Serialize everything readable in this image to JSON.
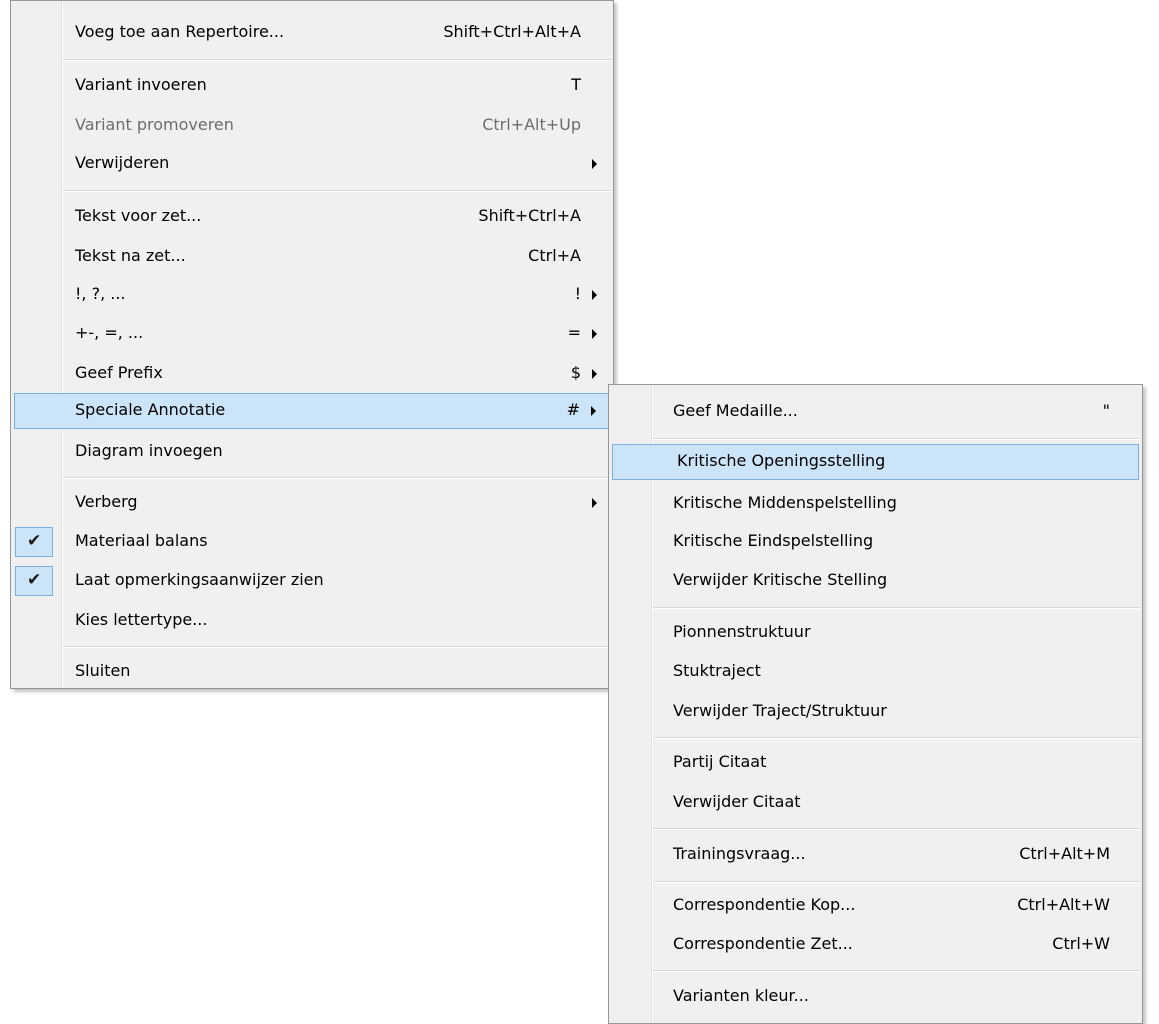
{
  "main_menu": {
    "items": [
      {
        "label": "Voeg toe aan Repertoire...",
        "shortcut": "Shift+Ctrl+Alt+A"
      },
      {
        "label": "Variant invoeren",
        "shortcut": "T"
      },
      {
        "label": "Variant promoveren",
        "shortcut": "Ctrl+Alt+Up",
        "disabled": true
      },
      {
        "label": "Verwijderen",
        "shortcut": ""
      },
      {
        "label": "Tekst voor zet...",
        "shortcut": "Shift+Ctrl+A"
      },
      {
        "label": "Tekst na zet...",
        "shortcut": "Ctrl+A"
      },
      {
        "label": "!, ?, ...",
        "shortcut": "!"
      },
      {
        "label": "+-, =, ...",
        "shortcut": "="
      },
      {
        "label": "Geef Prefix",
        "shortcut": "$"
      },
      {
        "label": "Speciale Annotatie",
        "shortcut": "#",
        "highlighted": true
      },
      {
        "label": "Diagram invoegen",
        "shortcut": ""
      },
      {
        "label": "Verberg",
        "shortcut": ""
      },
      {
        "label": "Materiaal balans",
        "shortcut": "",
        "checked": true
      },
      {
        "label": "Laat opmerkingsaanwijzer zien",
        "shortcut": "",
        "checked": true
      },
      {
        "label": "Kies lettertype...",
        "shortcut": ""
      },
      {
        "label": "Sluiten",
        "shortcut": ""
      }
    ]
  },
  "sub_menu": {
    "items": [
      {
        "label": "Geef Medaille...",
        "shortcut": "\""
      },
      {
        "label": "Kritische Openingsstelling",
        "shortcut": "",
        "highlighted": true
      },
      {
        "label": "Kritische Middenspelstelling",
        "shortcut": ""
      },
      {
        "label": "Kritische Eindspelstelling",
        "shortcut": ""
      },
      {
        "label": "Verwijder Kritische Stelling",
        "shortcut": ""
      },
      {
        "label": "Pionnenstruktuur",
        "shortcut": ""
      },
      {
        "label": "Stuktraject",
        "shortcut": ""
      },
      {
        "label": "Verwijder Traject/Struktuur",
        "shortcut": ""
      },
      {
        "label": "Partij Citaat",
        "shortcut": ""
      },
      {
        "label": "Verwijder Citaat",
        "shortcut": ""
      },
      {
        "label": "Trainingsvraag...",
        "shortcut": "Ctrl+Alt+M"
      },
      {
        "label": "Correspondentie Kop...",
        "shortcut": "Ctrl+Alt+W"
      },
      {
        "label": "Correspondentie Zet...",
        "shortcut": "Ctrl+W"
      },
      {
        "label": "Varianten kleur...",
        "shortcut": ""
      }
    ]
  },
  "icons": {
    "check": "✔",
    "submenu_arrow": "submenu-arrow-icon"
  },
  "colors": {
    "menu_bg": "#f0f0f0",
    "highlight_bg": "#cce4f7",
    "highlight_border": "#7ab1e0",
    "disabled_text": "#6d6d6d"
  }
}
